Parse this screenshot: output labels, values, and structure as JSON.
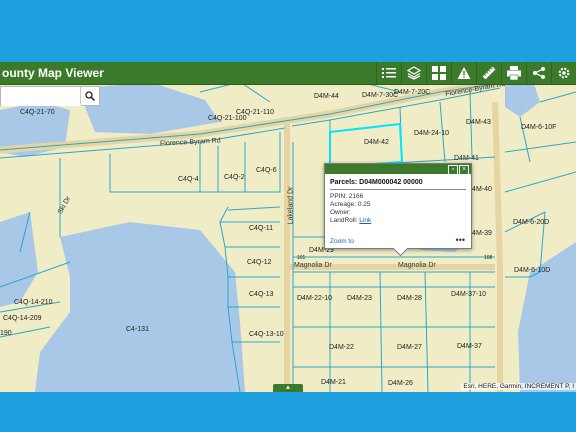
{
  "header": {
    "title": "ounty Map Viewer",
    "tools": [
      {
        "name": "legend-icon"
      },
      {
        "name": "layers-icon"
      },
      {
        "name": "basemap-gallery-icon"
      },
      {
        "name": "warning-icon"
      },
      {
        "name": "measure-icon"
      },
      {
        "name": "print-icon"
      },
      {
        "name": "share-icon"
      },
      {
        "name": "settings-icon"
      }
    ]
  },
  "search": {
    "placeholder": "",
    "icon": "search-icon"
  },
  "map": {
    "water_color": "#a9c8e8",
    "land_color": "#f0ecc6",
    "parcel_line_color": "#2aa7c9",
    "roads": {
      "florence_byram_1": "Florence-Byram Rd",
      "florence_byram_2": "Florence-Byram Rd",
      "magnolia_1": "Magnolia Dr",
      "magnolia_2": "Magnolia Dr",
      "lakeland": "Lakeland Dr",
      "ski": "Ski Dr"
    },
    "parcels": [
      "C4Q-21-70",
      "C4Q-21-100",
      "C4Q-21-110",
      "D4M-44",
      "D4M-7-30C",
      "D4M-7-20C",
      "D4M-43",
      "D4M-42",
      "D4M-24-10",
      "D4M-41",
      "D4M-6-10F",
      "C4Q-4",
      "C4Q-2",
      "C4Q-6",
      "C4Q-11",
      "C4Q-12",
      "C4Q-13",
      "C4Q-13-10",
      "D4M-29",
      "D4M-40",
      "D4M-39",
      "D4M-6-20D",
      "D4M-6-10D",
      "D4M-22-10",
      "D4M-23",
      "D4M-28",
      "D4M-37-10",
      "D4M-22",
      "D4M-27",
      "D4M-37",
      "D4M-21",
      "D4M-26",
      "C4-131",
      "C4Q-14-210",
      "C4Q-14-209",
      "190",
      "101",
      "108"
    ]
  },
  "popup": {
    "title": "Parcels: D04M000042 00000",
    "ppin": "PPIN: 2166",
    "acreage": "Acreage: 0.25",
    "owner": "Owner:",
    "landroll_label": "LandRoll:",
    "landroll_link": "Link",
    "zoom": "Zoom to",
    "more": "•••"
  },
  "attribution": "Esri, HERE, Garmin, INCREMENT P, I",
  "toggle_label": "▲"
}
